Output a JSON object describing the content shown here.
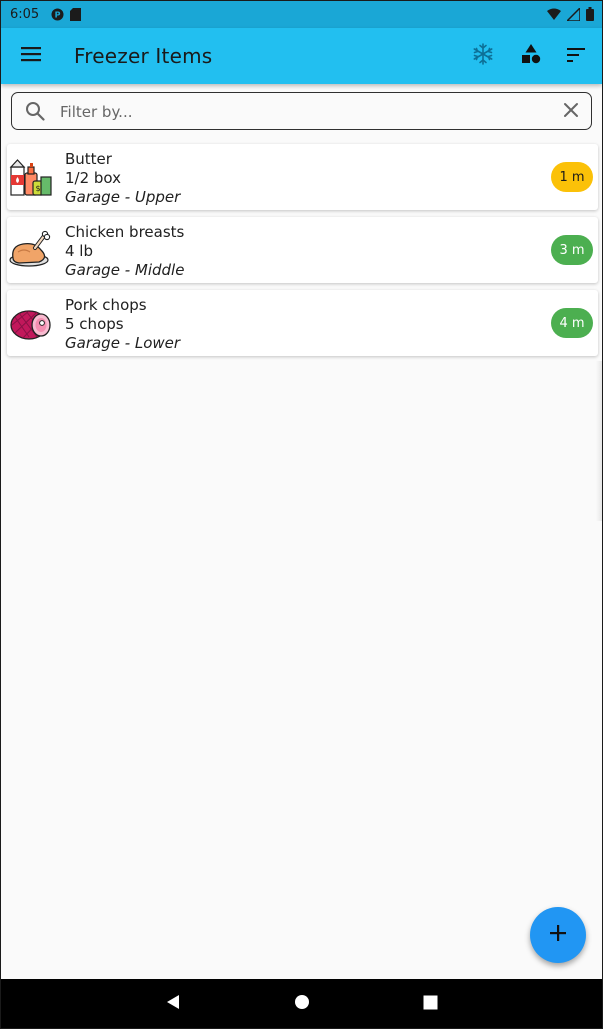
{
  "status": {
    "time": "6:05"
  },
  "app": {
    "title": "Freezer Items"
  },
  "search": {
    "placeholder": "Filter by...",
    "value": ""
  },
  "items": [
    {
      "name": "Butter",
      "quantity": "1/2 box",
      "location": "Garage - Upper",
      "age": "1 m",
      "badge_color": "#fbc108",
      "icon": "groceries-icon"
    },
    {
      "name": "Chicken breasts",
      "quantity": "4 lb",
      "location": "Garage - Middle",
      "age": "3 m",
      "badge_color": "#4caf50",
      "icon": "roast-chicken-icon"
    },
    {
      "name": "Pork chops",
      "quantity": "5 chops",
      "location": "Garage - Lower",
      "age": "4 m",
      "badge_color": "#4caf50",
      "icon": "ham-icon"
    }
  ],
  "colors": {
    "app_bar": "#22bff0",
    "status_bar": "#1aa7d6",
    "fab": "#2196f3"
  }
}
